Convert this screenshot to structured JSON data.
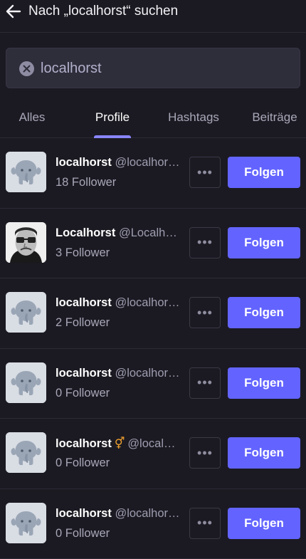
{
  "header": {
    "title": "Nach „localhorst“ suchen"
  },
  "search": {
    "value": "localhorst",
    "placeholder": ""
  },
  "tabs": [
    {
      "label": "Alles"
    },
    {
      "label": "Profile"
    },
    {
      "label": "Hashtags"
    },
    {
      "label": "Beiträge"
    }
  ],
  "active_tab": "Profile",
  "colors": {
    "accent": "#6364ff",
    "background": "#1b1a22",
    "tab_indicator": "#8a86ff"
  },
  "results": [
    {
      "name": "localhorst",
      "emoji": "",
      "handle": "@localhor…",
      "followers": "18 Follower",
      "avatar": "default-elephant",
      "more": "•••",
      "follow": "Folgen"
    },
    {
      "name": "Localhorst",
      "emoji": "",
      "handle": "@Localh…",
      "followers": "3 Follower",
      "avatar": "photo-man-glasses",
      "more": "•••",
      "follow": "Folgen"
    },
    {
      "name": "localhorst",
      "emoji": "",
      "handle": "@localhor…",
      "followers": "2 Follower",
      "avatar": "default-elephant",
      "more": "•••",
      "follow": "Folgen"
    },
    {
      "name": "localhorst",
      "emoji": "",
      "handle": "@localhor…",
      "followers": "0 Follower",
      "avatar": "default-elephant",
      "more": "•••",
      "follow": "Folgen"
    },
    {
      "name": "localhorst",
      "emoji": "⚥",
      "handle": "@local…",
      "followers": "0 Follower",
      "avatar": "default-elephant",
      "more": "•••",
      "follow": "Folgen"
    },
    {
      "name": "localhorst",
      "emoji": "",
      "handle": "@localhor…",
      "followers": "0 Follower",
      "avatar": "default-elephant",
      "more": "•••",
      "follow": "Folgen"
    }
  ]
}
